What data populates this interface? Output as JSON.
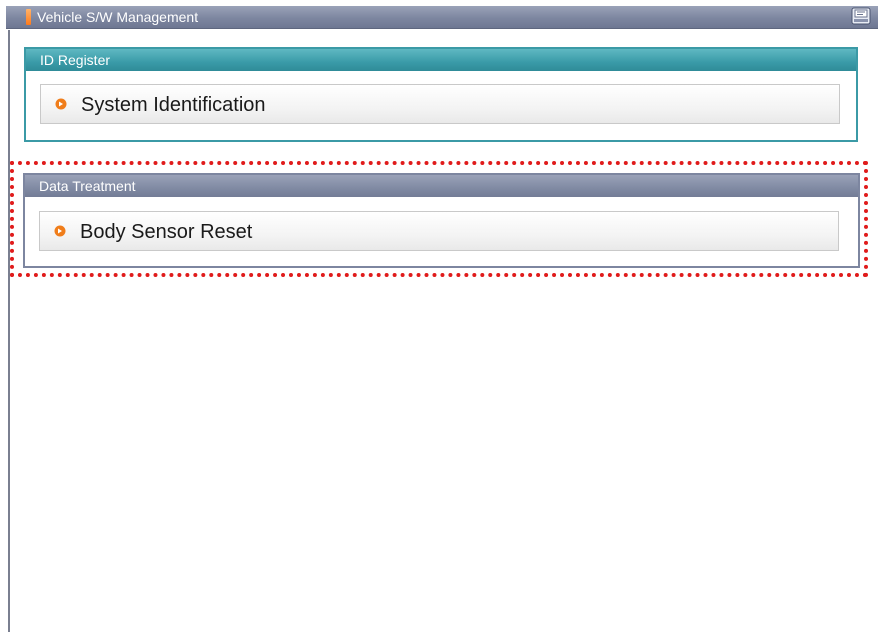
{
  "window": {
    "title": "Vehicle S/W Management",
    "title_marker_color": "#ff7a1a",
    "help_icon": "help-book-icon"
  },
  "panels": [
    {
      "header": "ID Register",
      "accent_color": "#3a9ba8",
      "items": [
        {
          "label": "System Identification",
          "icon": "orange-arrow-bullet-icon"
        }
      ]
    },
    {
      "header": "Data Treatment",
      "accent_color": "#808aa3",
      "highlighted": true,
      "highlight_color": "#e01b1b",
      "items": [
        {
          "label": "Body Sensor Reset",
          "icon": "orange-arrow-bullet-icon"
        }
      ]
    }
  ]
}
